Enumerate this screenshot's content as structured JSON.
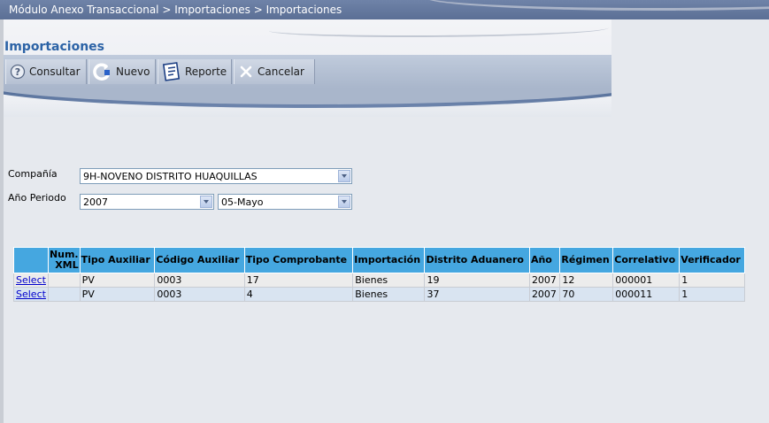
{
  "breadcrumb": "Módulo Anexo Transaccional > Importaciones > Importaciones",
  "page_title": "Importaciones",
  "toolbar": {
    "consultar": "Consultar",
    "nuevo": "Nuevo",
    "reporte": "Reporte",
    "cancelar": "Cancelar"
  },
  "form": {
    "compania_label": "Compañía",
    "compania_value": "9H-NOVENO DISTRITO HUAQUILLAS",
    "anio_periodo_label": "Año Periodo",
    "anio_value": "2007",
    "periodo_value": "05-Mayo"
  },
  "grid": {
    "headers": [
      "",
      "Num. XML",
      "Tipo Auxiliar",
      "Código Auxiliar",
      "Tipo Comprobante",
      "Importación",
      "Distrito Aduanero",
      "Año",
      "Régimen",
      "Correlativo",
      "Verificador"
    ],
    "rows": [
      [
        "Select",
        "",
        "PV",
        "0003",
        "17",
        "Bienes",
        "19",
        "2007",
        "12",
        "000001",
        "1"
      ],
      [
        "Select",
        "",
        "PV",
        "0003",
        "4",
        "Bienes",
        "37",
        "2007",
        "70",
        "000011",
        "1"
      ]
    ]
  },
  "colors": {
    "title": "#2c63a6",
    "grid_header": "#45a7e0",
    "topbar": "#5b6f95",
    "link": "#0000cc"
  },
  "icons": {
    "consultar": "help-icon",
    "nuevo": "refresh-icon",
    "reporte": "report-icon",
    "cancelar": "close-icon"
  }
}
